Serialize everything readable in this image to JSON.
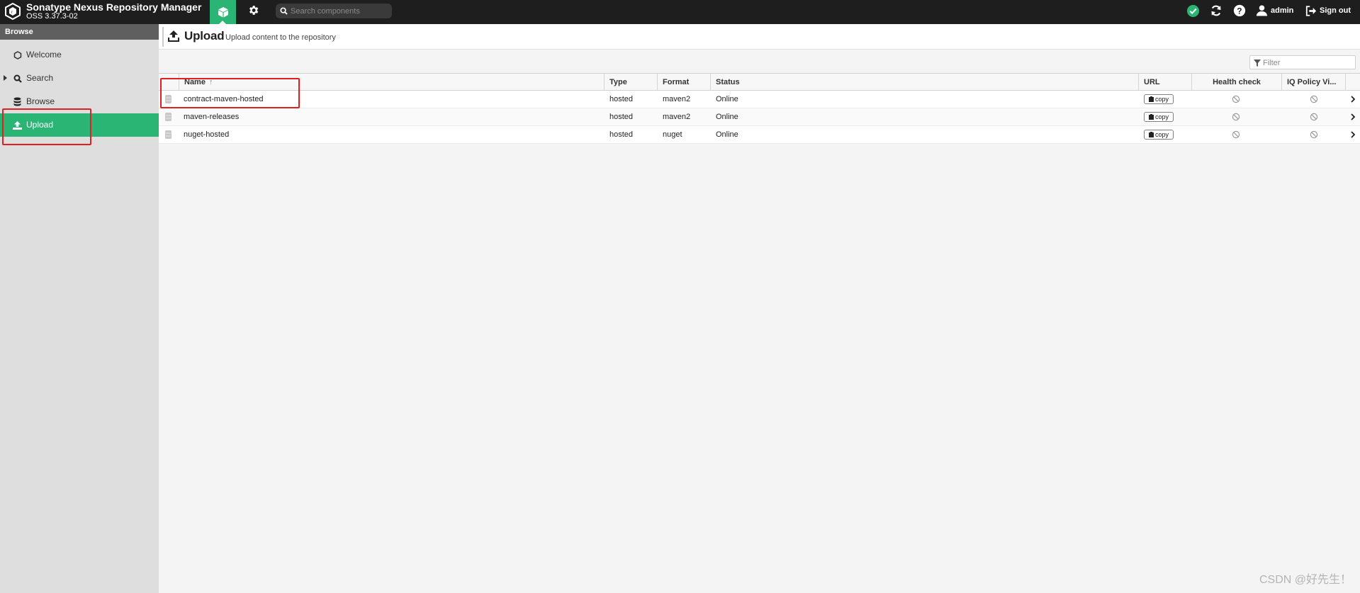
{
  "header": {
    "app_title": "Sonatype Nexus Repository Manager",
    "version": "OSS 3.37.3-02",
    "search_placeholder": "Search components",
    "user_label": "admin",
    "signout_label": "Sign out",
    "icons": [
      "product-logo-icon",
      "cube-icon",
      "gear-icon",
      "search-icon",
      "check-circle-icon",
      "refresh-icon",
      "help-icon",
      "user-icon",
      "sign-out-icon"
    ]
  },
  "sidebar": {
    "section_title": "Browse",
    "items": [
      {
        "label": "Welcome",
        "icon": "hexagon-icon"
      },
      {
        "label": "Search",
        "icon": "search-icon"
      },
      {
        "label": "Browse",
        "icon": "database-icon"
      },
      {
        "label": "Upload",
        "icon": "upload-icon"
      }
    ]
  },
  "page": {
    "title": "Upload",
    "subtitle": "Upload content to the repository",
    "filter_placeholder": "Filter"
  },
  "table": {
    "columns": [
      "Name",
      "Type",
      "Format",
      "Status",
      "URL",
      "Health check",
      "IQ Policy Vi..."
    ],
    "sort_indicator": "↑",
    "copy_label": "copy",
    "rows": [
      {
        "name": "contract-maven-hosted",
        "type": "hosted",
        "format": "maven2",
        "status": "Online"
      },
      {
        "name": "maven-releases",
        "type": "hosted",
        "format": "maven2",
        "status": "Online"
      },
      {
        "name": "nuget-hosted",
        "type": "hosted",
        "format": "nuget",
        "status": "Online"
      }
    ]
  },
  "watermark": "CSDN @好先生！",
  "colors": {
    "accent": "#2bb574",
    "header_bg": "#1e1e1e",
    "annotation": "#e02020"
  }
}
